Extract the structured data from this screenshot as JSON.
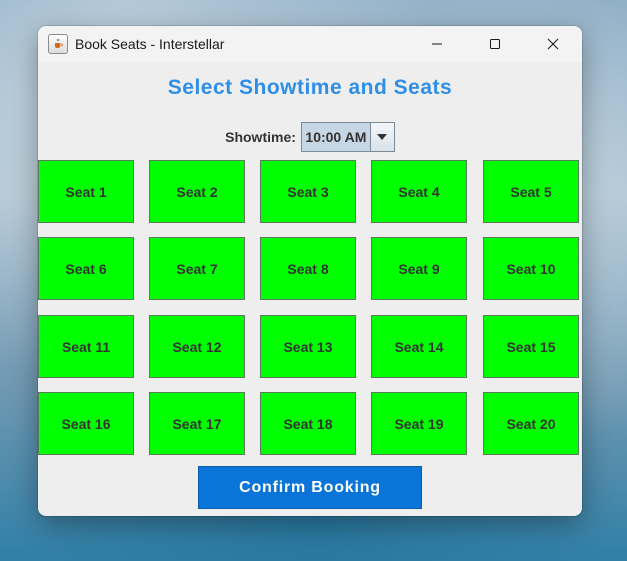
{
  "window": {
    "title": "Book Seats - Interstellar",
    "icon": "java-cup-icon",
    "controls": [
      "minimize-icon",
      "maximize-icon",
      "close-icon"
    ]
  },
  "heading": "Select Showtime and Seats",
  "showtime": {
    "label": "Showtime:",
    "selected": "10:00 AM"
  },
  "seats": [
    "Seat 1",
    "Seat 2",
    "Seat 3",
    "Seat 4",
    "Seat 5",
    "Seat 6",
    "Seat 7",
    "Seat 8",
    "Seat 9",
    "Seat 10",
    "Seat 11",
    "Seat 12",
    "Seat 13",
    "Seat 14",
    "Seat 15",
    "Seat 16",
    "Seat 17",
    "Seat 18",
    "Seat 19",
    "Seat 20"
  ],
  "confirm_label": "Confirm Booking",
  "colors": {
    "heading": "#2f8fe8",
    "seat_available": "#00ff00",
    "confirm_button": "#0a74d9"
  }
}
